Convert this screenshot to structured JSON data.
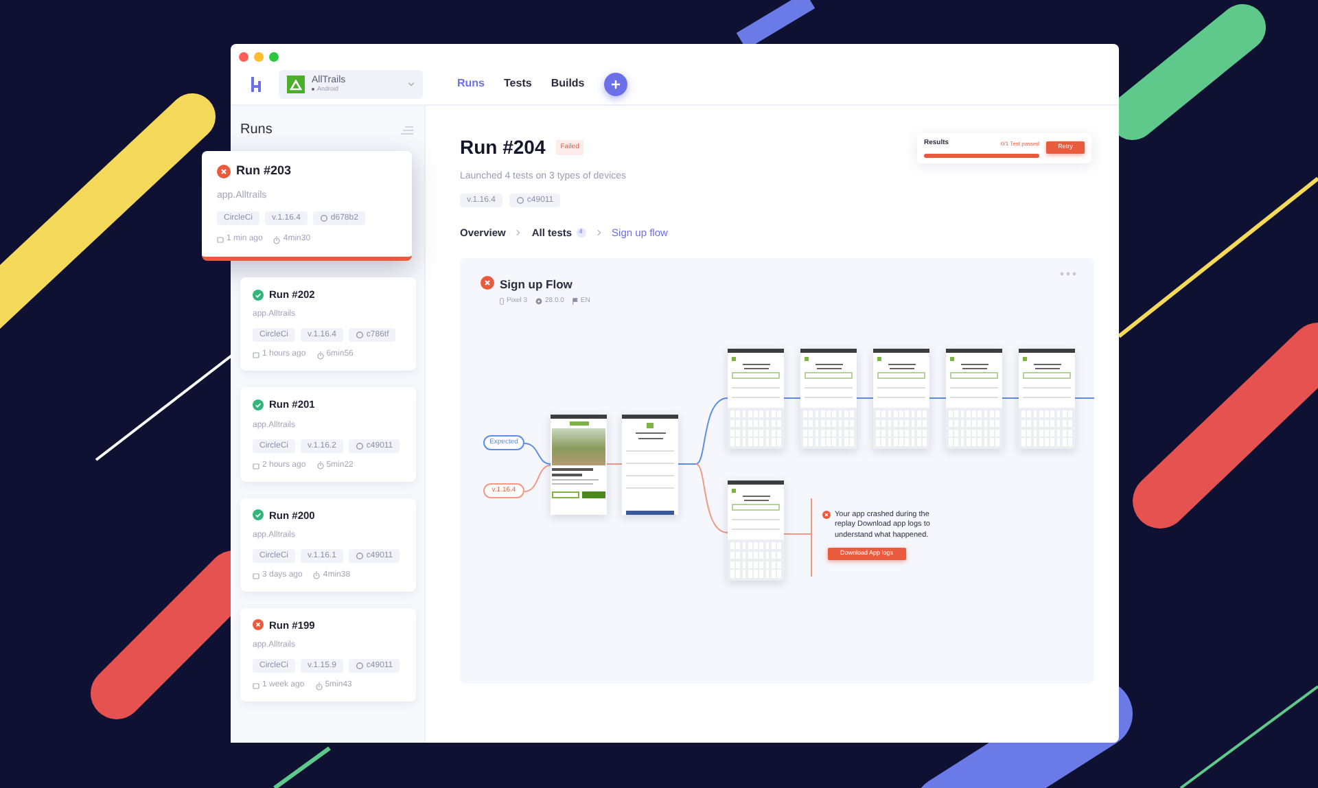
{
  "app_switcher": {
    "name": "AllTrails",
    "platform": "Android"
  },
  "nav": [
    {
      "label": "Runs",
      "selected": true
    },
    {
      "label": "Tests",
      "selected": false
    },
    {
      "label": "Builds",
      "selected": false
    }
  ],
  "sidebar": {
    "title": "Runs",
    "runs": [
      {
        "title": "Run #203",
        "kind": "failed",
        "selected": true,
        "app": "app.Alltrails",
        "ci": "CircleCi",
        "version": "v.1.16.4",
        "commit": "d678b2",
        "time": "1 min ago",
        "duration": "4min30"
      },
      {
        "title": "Run #202",
        "kind": "passed",
        "selected": false,
        "app": "app.Alltrails",
        "ci": "CircleCi",
        "version": "v.1.16.4",
        "commit": "c786tf",
        "time": "1 hours ago",
        "duration": "6min56"
      },
      {
        "title": "Run #201",
        "kind": "passed",
        "selected": false,
        "app": "app.Alltrails",
        "ci": "CircleCi",
        "version": "v.1.16.2",
        "commit": "c49011",
        "time": "2 hours ago",
        "duration": "5min22"
      },
      {
        "title": "Run #200",
        "kind": "passed",
        "selected": false,
        "app": "app.Alltrails",
        "ci": "CircleCi",
        "version": "v.1.16.1",
        "commit": "c49011",
        "time": "3 days ago",
        "duration": "4min38"
      },
      {
        "title": "Run #199",
        "kind": "failed",
        "selected": false,
        "app": "app.Alltrails",
        "ci": "CircleCi",
        "version": "v.1.15.9",
        "commit": "c49011",
        "time": "1 week ago",
        "duration": "5min43"
      }
    ]
  },
  "run": {
    "title": "Run #204",
    "kind": "failed",
    "status_badge": "Failed",
    "subtitle": "Launched 4 tests on 3 types of devices",
    "version": "v.1.16.4",
    "commit": "c49011"
  },
  "results": {
    "label": "Results",
    "summary": "0/1 Test passed",
    "level": 1,
    "button": "Retry"
  },
  "breadcrumb": [
    {
      "label": "Overview",
      "selected": false
    },
    {
      "label": "All tests",
      "count": "4",
      "selected": false
    },
    {
      "label": "Sign up flow",
      "selected": true
    }
  ],
  "flow": {
    "title": "Sign up Flow",
    "kind": "failed",
    "device": "Pixel 3",
    "os": "28.0.0",
    "language": "EN",
    "branches": [
      {
        "label": "Expected",
        "kind": "expected"
      },
      {
        "label": "v.1.16.4",
        "kind": "actual"
      }
    ],
    "shared_screens": [
      {
        "kind": "landing"
      },
      {
        "kind": "form"
      }
    ],
    "expected_screens": [
      {
        "kind": "keyboard"
      },
      {
        "kind": "keyboard"
      },
      {
        "kind": "keyboard"
      },
      {
        "kind": "keyboard"
      },
      {
        "kind": "keyboard"
      }
    ],
    "actual_screens": [
      {
        "kind": "keyboard"
      }
    ],
    "error": {
      "message": "Your app crashed during the replay Download app logs to understand what happened.",
      "button": "Download App logs"
    }
  }
}
